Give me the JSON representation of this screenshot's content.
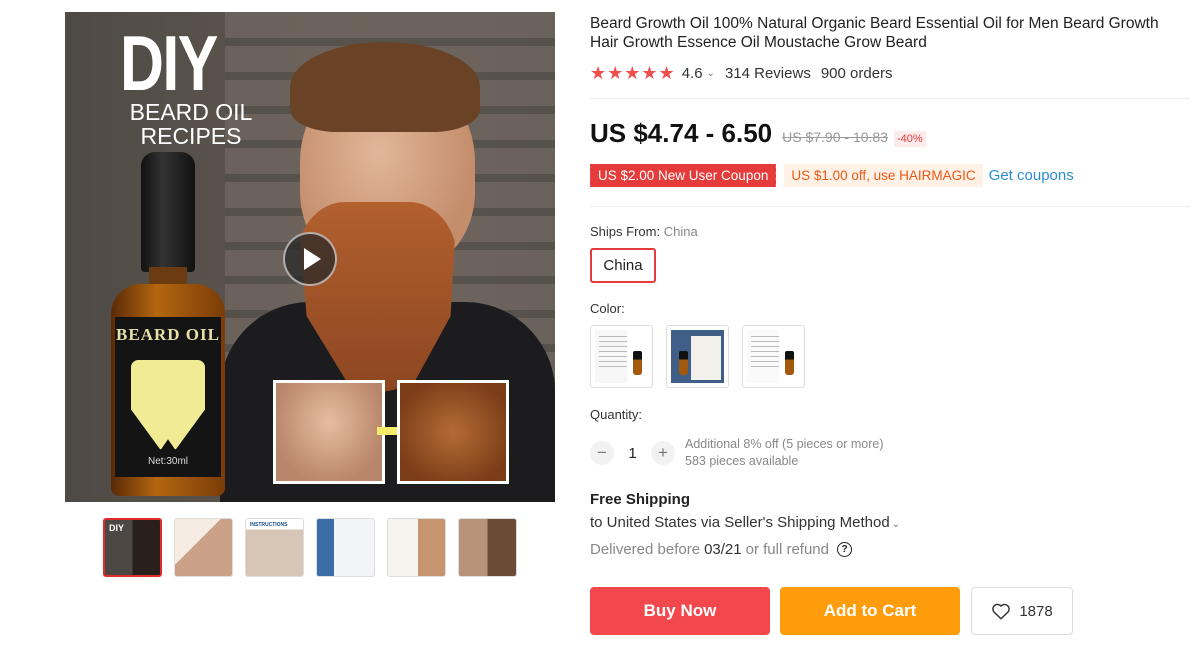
{
  "gallery": {
    "main_image": {
      "diy_text": "DIY",
      "recipes_text": "BEARD OIL\nRECIPES",
      "bottle_label": "BEARD OIL",
      "bottle_volume": "Net:30ml"
    },
    "thumbnails": [
      {
        "name": "thumbnail-1",
        "mini": "DIY",
        "active": true
      },
      {
        "name": "thumbnail-2",
        "mini": "",
        "active": false
      },
      {
        "name": "thumbnail-3",
        "mini": "INSTRUCTIONS",
        "active": false
      },
      {
        "name": "thumbnail-4",
        "mini": "",
        "active": false
      },
      {
        "name": "thumbnail-5",
        "mini": "",
        "active": false
      },
      {
        "name": "thumbnail-6",
        "mini": "",
        "active": false
      }
    ]
  },
  "product": {
    "title": "Beard Growth Oil 100% Natural Organic Beard Essential Oil for Men Beard Growth Hair Growth Essence Oil Moustache Grow Beard",
    "rating": "4.6",
    "stars": "★★★★★",
    "reviews": "314 Reviews",
    "orders": "900 orders",
    "price": "US $4.74 - 6.50",
    "original_price": "US $7.90 - 10.83",
    "discount": "-40%",
    "coupon_new_user": "US $2.00 New User Coupon",
    "coupon_code": "US $1.00 off, use HAIRMAGIC",
    "get_coupons": "Get coupons",
    "ships_from_label": "Ships From:",
    "ships_from_value": "China",
    "ships_from_option": "China",
    "color_label": "Color:",
    "quantity_label": "Quantity:",
    "quantity_value": "1",
    "qty_minus": "−",
    "qty_plus": "+",
    "qty_note_1": "Additional 8% off (5 pieces or more)",
    "qty_note_2": "583 pieces available",
    "free_shipping": "Free Shipping",
    "ship_method": "to United States via Seller's Shipping Method",
    "delivered_prefix": "Delivered before",
    "delivered_date": "03/21",
    "delivered_suffix": "or full refund",
    "help_glyph": "?",
    "buy_now": "Buy Now",
    "add_to_cart": "Add to Cart",
    "wishlist_count": "1878"
  },
  "colors": {
    "accent_red": "#f2484d",
    "cart_orange": "#fe9c0c",
    "link_blue": "#2c8dcd",
    "star_red": "#f04d4d"
  },
  "icons": [
    "play-icon",
    "arrow-icon",
    "star-icon",
    "chevron-down-icon",
    "help-icon",
    "heart-icon"
  ]
}
